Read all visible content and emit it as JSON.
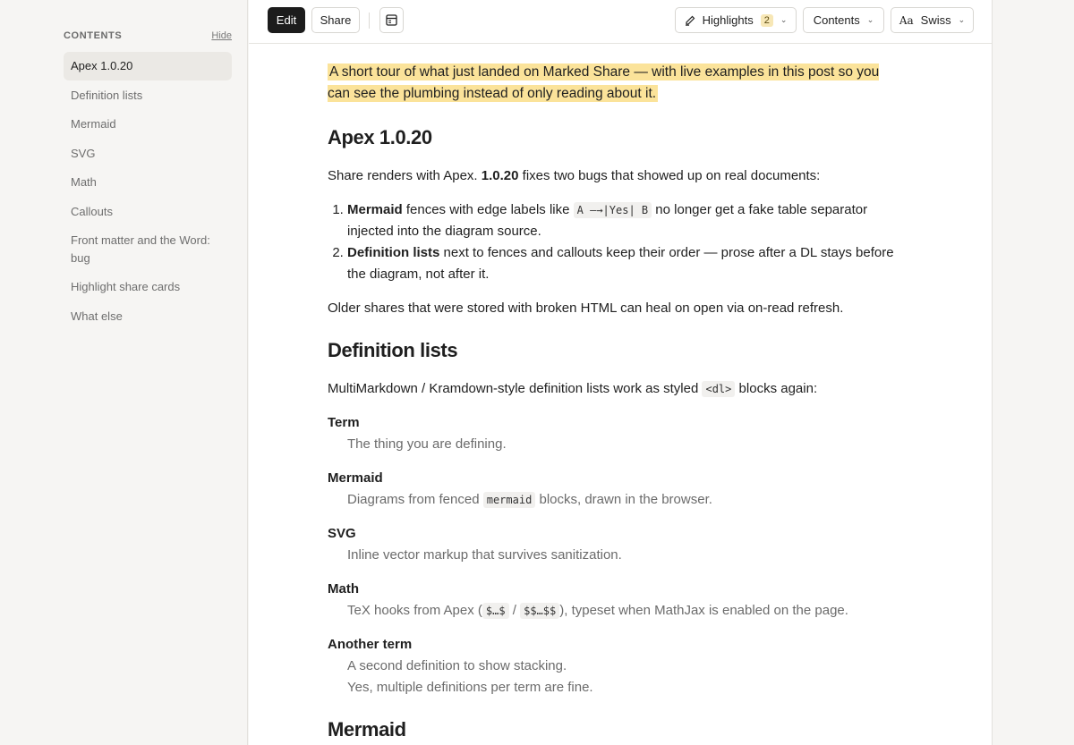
{
  "sidebar": {
    "title": "CONTENTS",
    "hide_label": "Hide",
    "items": [
      "Apex 1.0.20",
      "Definition lists",
      "Mermaid",
      "SVG",
      "Math",
      "Callouts",
      "Front matter and the Word: bug",
      "Highlight share cards",
      "What else"
    ],
    "active_index": 0
  },
  "toolbar": {
    "edit_label": "Edit",
    "share_label": "Share",
    "highlights_label": "Highlights",
    "highlights_count": "2",
    "contents_label": "Contents",
    "font_glyph": "Aa",
    "font_label": "Swiss"
  },
  "article": {
    "lede": "A short tour of what just landed on Marked Share — with live examples in this post so you can see the plumbing instead of only reading about it.",
    "apex": {
      "heading": "Apex 1.0.20",
      "intro_a": "Share renders with Apex. ",
      "intro_version": "1.0.20",
      "intro_b": " fixes two bugs that showed up on real documents:",
      "item1_bold": "Mermaid",
      "item1_a": " fences with edge labels like ",
      "item1_code": "A —→|Yes| B",
      "item1_b": " no longer get a fake table separator injected into the diagram source.",
      "item2_bold": "Definition lists",
      "item2_text": " next to fences and callouts keep their order — prose after a DL stays before the diagram, not after it.",
      "outro": "Older shares that were stored with broken HTML can heal on open via on-read refresh."
    },
    "deflists": {
      "heading": "Definition lists",
      "intro_a": "MultiMarkdown / Kramdown-style definition lists work as styled ",
      "intro_code": "<dl>",
      "intro_b": " blocks again:",
      "term1": "Term",
      "def1": "The thing you are defining.",
      "term2": "Mermaid",
      "def2_a": "Diagrams from fenced ",
      "def2_code": "mermaid",
      "def2_b": " blocks, drawn in the browser.",
      "term3": "SVG",
      "def3": "Inline vector markup that survives sanitization.",
      "term4": "Math",
      "def4_a": "TeX hooks from Apex (",
      "def4_code1": "$…$",
      "def4_sep": " / ",
      "def4_code2": "$$…$$",
      "def4_b": "), typeset when MathJax is enabled on the page.",
      "term5": "Another term",
      "def5a": "A second definition to show stacking.",
      "def5b": "Yes, multiple definitions per term are fine."
    },
    "mermaid_heading": "Mermaid"
  },
  "colors": {
    "highlight": "#fbe39a",
    "dark_button": "#1c1c1c",
    "sidebar_bg": "#f6f5f3"
  }
}
